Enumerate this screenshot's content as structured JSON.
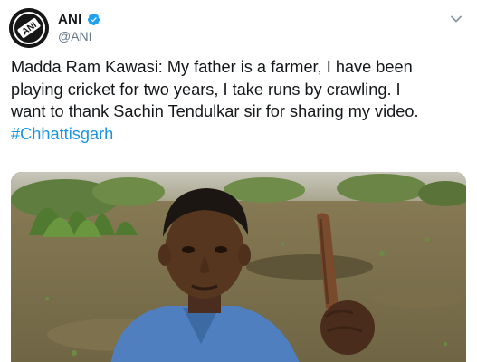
{
  "tweet": {
    "author_name": "ANI",
    "handle": "@ANI",
    "verified": true,
    "text_lines": [
      "Madda Ram Kawasi: My father is a farmer, I have been",
      "playing cricket for two years, I take runs by crawling. I",
      "want to thank Sachin Tendulkar sir for sharing my video."
    ],
    "hashtag": "#Chhattisgarh",
    "avatar_logo_text": "ANI"
  },
  "colors": {
    "link": "#1b95e0",
    "text": "#14171a",
    "secondary": "#657786",
    "verified": "#1da1f2"
  },
  "icons": {
    "verified": "verified-badge-icon",
    "menu": "chevron-down-icon"
  }
}
